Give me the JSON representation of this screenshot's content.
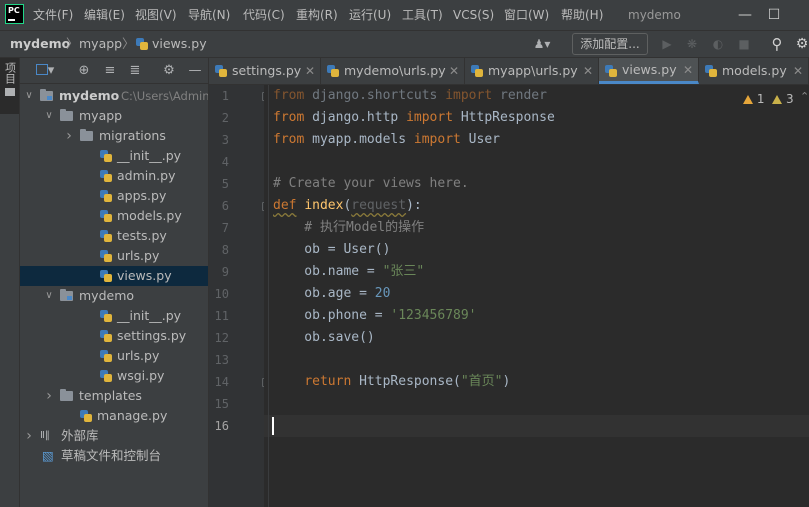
{
  "app": {
    "window_title": "mydemo",
    "menu": [
      "文件(F)",
      "编辑(E)",
      "视图(V)",
      "导航(N)",
      "代码(C)",
      "重构(R)",
      "运行(U)",
      "工具(T)",
      "VCS(S)",
      "窗口(W)",
      "帮助(H)"
    ],
    "logo_text": "PC"
  },
  "navbar": {
    "breadcrumbs": [
      "mydemo",
      "myapp",
      "views.py"
    ],
    "add_config_label": "添加配置..."
  },
  "sidebar_tab_label": "项目",
  "project_tree": [
    {
      "label": "mydemo",
      "path": "C:\\Users\\Admin",
      "type": "module-folder",
      "depth": 0,
      "expanded": true
    },
    {
      "label": "myapp",
      "type": "folder",
      "depth": 1,
      "expanded": true
    },
    {
      "label": "migrations",
      "type": "folder",
      "depth": 2,
      "expanded": false
    },
    {
      "label": "__init__.py",
      "type": "py",
      "depth": 3
    },
    {
      "label": "admin.py",
      "type": "py",
      "depth": 3
    },
    {
      "label": "apps.py",
      "type": "py",
      "depth": 3
    },
    {
      "label": "models.py",
      "type": "py",
      "depth": 3
    },
    {
      "label": "tests.py",
      "type": "py",
      "depth": 3
    },
    {
      "label": "urls.py",
      "type": "py",
      "depth": 3
    },
    {
      "label": "views.py",
      "type": "py",
      "depth": 3,
      "selected": true
    },
    {
      "label": "mydemo",
      "type": "module-folder",
      "depth": 1,
      "expanded": true
    },
    {
      "label": "__init__.py",
      "type": "py",
      "depth": 3
    },
    {
      "label": "settings.py",
      "type": "py",
      "depth": 3
    },
    {
      "label": "urls.py",
      "type": "py",
      "depth": 3
    },
    {
      "label": "wsgi.py",
      "type": "py",
      "depth": 3
    },
    {
      "label": "templates",
      "type": "folder",
      "depth": 1,
      "expanded": false
    },
    {
      "label": "manage.py",
      "type": "py",
      "depth": 2
    },
    {
      "label": "外部库",
      "type": "lib",
      "depth": 0,
      "expanded": false
    },
    {
      "label": "草稿文件和控制台",
      "type": "scratch",
      "depth": 0
    }
  ],
  "editor_tabs": [
    {
      "label": "settings.py",
      "active": false
    },
    {
      "label": "mydemo\\urls.py",
      "active": false
    },
    {
      "label": "myapp\\urls.py",
      "active": false
    },
    {
      "label": "views.py",
      "active": true
    },
    {
      "label": "models.py",
      "active": false
    }
  ],
  "inspections": {
    "warnings": "1",
    "weak_warnings": "3"
  },
  "code_lines": [
    "from django.shortcuts import render",
    "from django.http import HttpResponse",
    "from myapp.models import User",
    "",
    "# Create your views here.",
    "def index(request):",
    "    # 执行Model的操作",
    "    ob = User()",
    "    ob.name = \"张三\"",
    "    ob.age = 20",
    "    ob.phone = '123456789'",
    "    ob.save()",
    "",
    "    return HttpResponse(\"首页\")",
    "",
    ""
  ],
  "current_line": 16
}
